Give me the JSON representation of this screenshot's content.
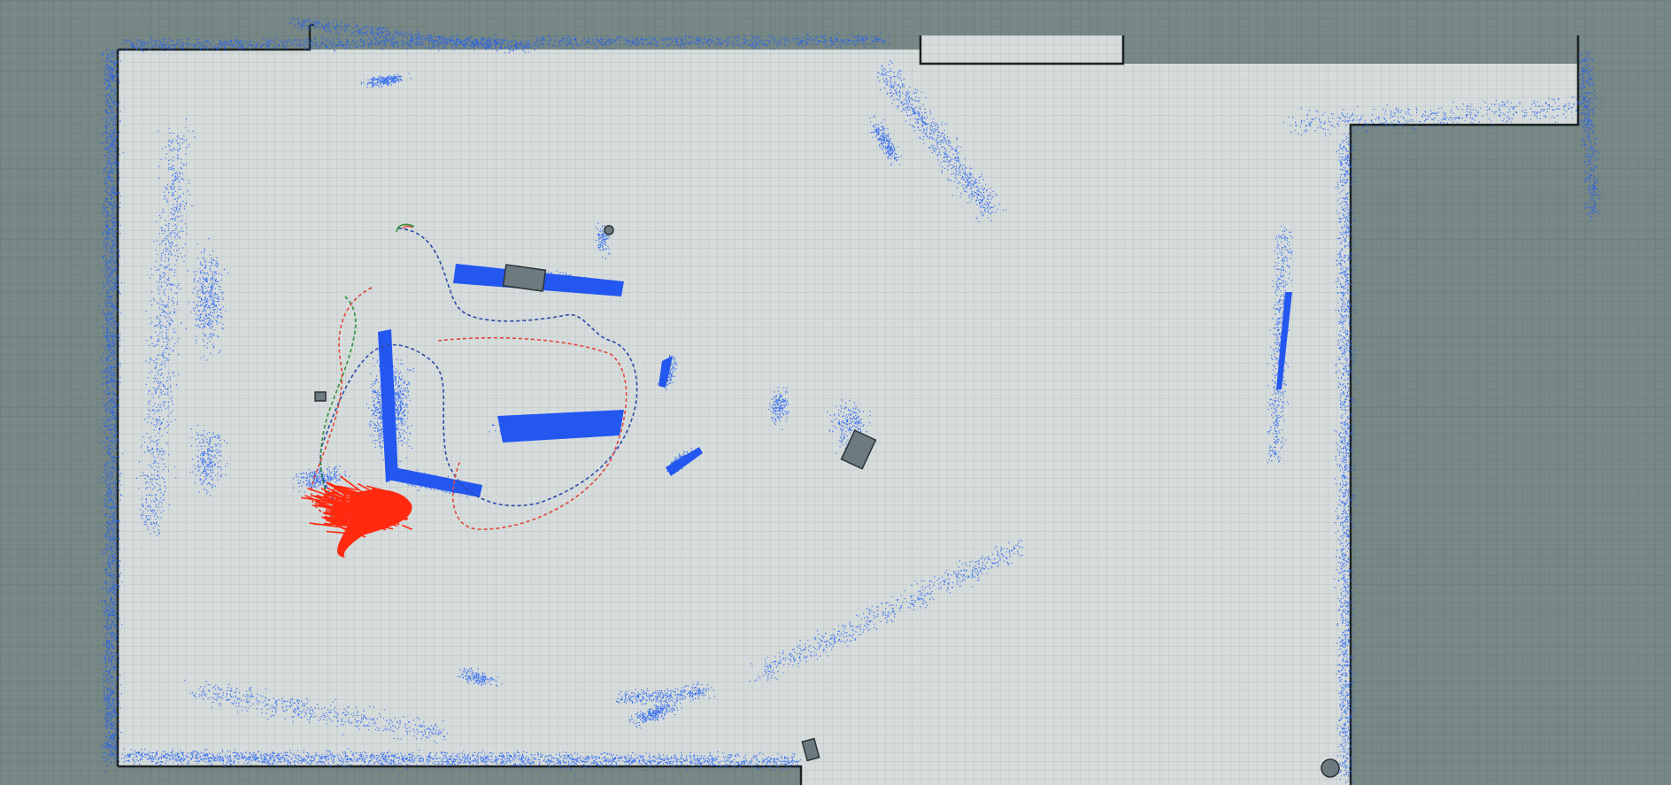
{
  "view": {
    "type": "occupancy-grid-map",
    "colors": {
      "unknown": "#778886",
      "free_space": "#d6dcdc",
      "grid_line": "#b3bcbc",
      "wall": "#1c2222",
      "obstacle": "#6d7b80",
      "laser_points": "#1f5ef5",
      "pose_array": "#ff2a10",
      "global_plan": "#2f8f3a",
      "local_plan": "#e0473a",
      "trajectory": "#2a4aa8"
    }
  },
  "layers": [
    {
      "name": "map-grid",
      "icon": "grid-icon"
    },
    {
      "name": "laser-scan-points",
      "icon": "point-cloud-icon"
    },
    {
      "name": "particle-cloud",
      "icon": "arrow-cluster-icon"
    },
    {
      "name": "robot-paths",
      "icon": "path-icon"
    },
    {
      "name": "obstacles",
      "icon": "box-icon"
    }
  ]
}
